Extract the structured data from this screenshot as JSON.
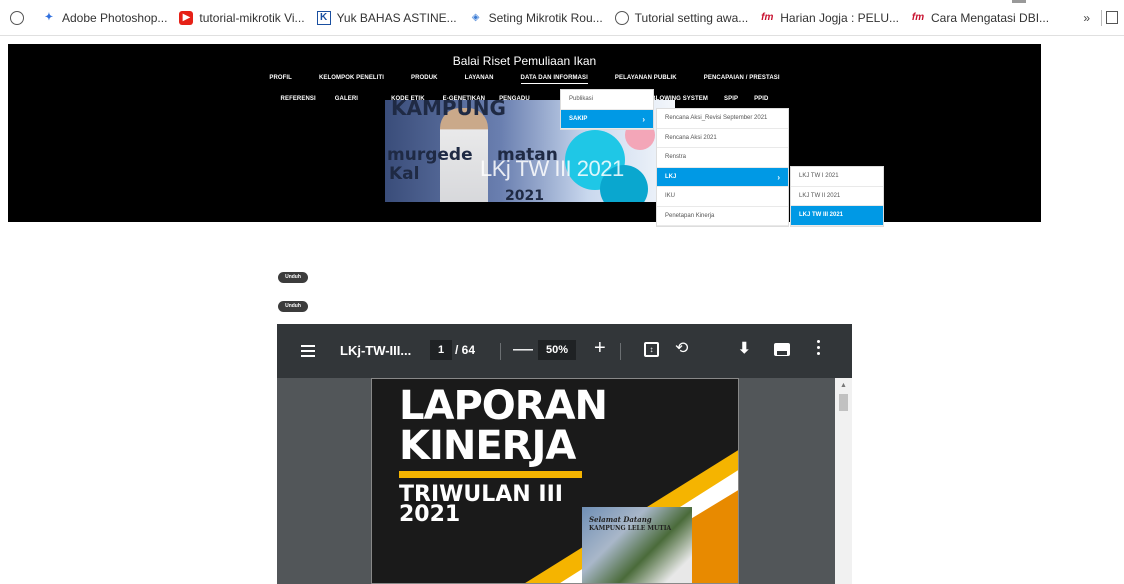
{
  "bookmarks": [
    {
      "icon": "globe-icon",
      "label": ""
    },
    {
      "icon": "photoshop-icon",
      "label": "Adobe Photoshop..."
    },
    {
      "icon": "youtube-icon",
      "label": "tutorial-mikrotik Vi..."
    },
    {
      "icon": "k-icon",
      "label": "Yuk BAHAS ASTINE..."
    },
    {
      "icon": "mikrotik-icon",
      "label": "Seting Mikrotik Rou..."
    },
    {
      "icon": "globe-icon",
      "label": "Tutorial setting awa..."
    },
    {
      "icon": "harian-jogja-icon",
      "label": "Harian Jogja : PELU..."
    },
    {
      "icon": "harian-jogja-icon",
      "label": "Cara Mengatasi DBI..."
    }
  ],
  "bookmarks_more": "»",
  "site": {
    "title": "Balai Riset Pemuliaan Ikan",
    "nav1": [
      "PROFIL",
      "KELOMPOK PENELITI",
      "PRODUK",
      "LAYANAN",
      "DATA DAN INFORMASI",
      "PELAYANAN PUBLIK",
      "PENCAPAIAN / PRESTASI"
    ],
    "nav2": [
      "REFERENSI",
      "GALERI",
      "KODE ETIK",
      "E-GENETIKAN",
      "PENGADU",
      "WHISTLE BLOWING SYSTEM",
      "SPIP",
      "PPID"
    ],
    "banner_words": [
      "KAMPUNG",
      "murgede",
      "Kal",
      "matan",
      "2021"
    ],
    "banner_overlay": "LKj TW III 2021"
  },
  "dropdown1": [
    "Publikasi",
    "SAKIP"
  ],
  "dropdown2": [
    "Rencana Aksi_Revisi September 2021",
    "Rencana Aksi 2021",
    "Renstra",
    "LKJ",
    "IKU",
    "Penetapan Kinerja"
  ],
  "dropdown3": [
    "LKJ TW I 2021",
    "LKJ TW II 2021",
    "LKJ TW III 2021"
  ],
  "unduh": [
    "Unduh",
    "Unduh"
  ],
  "pdf": {
    "title": "LKj-TW-III...",
    "page": "1",
    "total": "/ 64",
    "minus": "—",
    "zoom": "50%",
    "plus": "+",
    "rotate_glyph": "⟲",
    "download_glyph": "⬇",
    "scroll_up": "▲"
  },
  "cover": {
    "line1": "LAPORAN",
    "line2": "KINERJA",
    "line3": "TRIWULAN III",
    "line4": "2021",
    "photo_line1": "Selamat Datang",
    "photo_line2": "KAMPUNG LELE MUTIA"
  },
  "colors": {
    "dropdown_active": "#0099e5",
    "pdf_toolbar": "#323639",
    "pdf_background": "#525659",
    "cover_accent": "#f5b400"
  }
}
